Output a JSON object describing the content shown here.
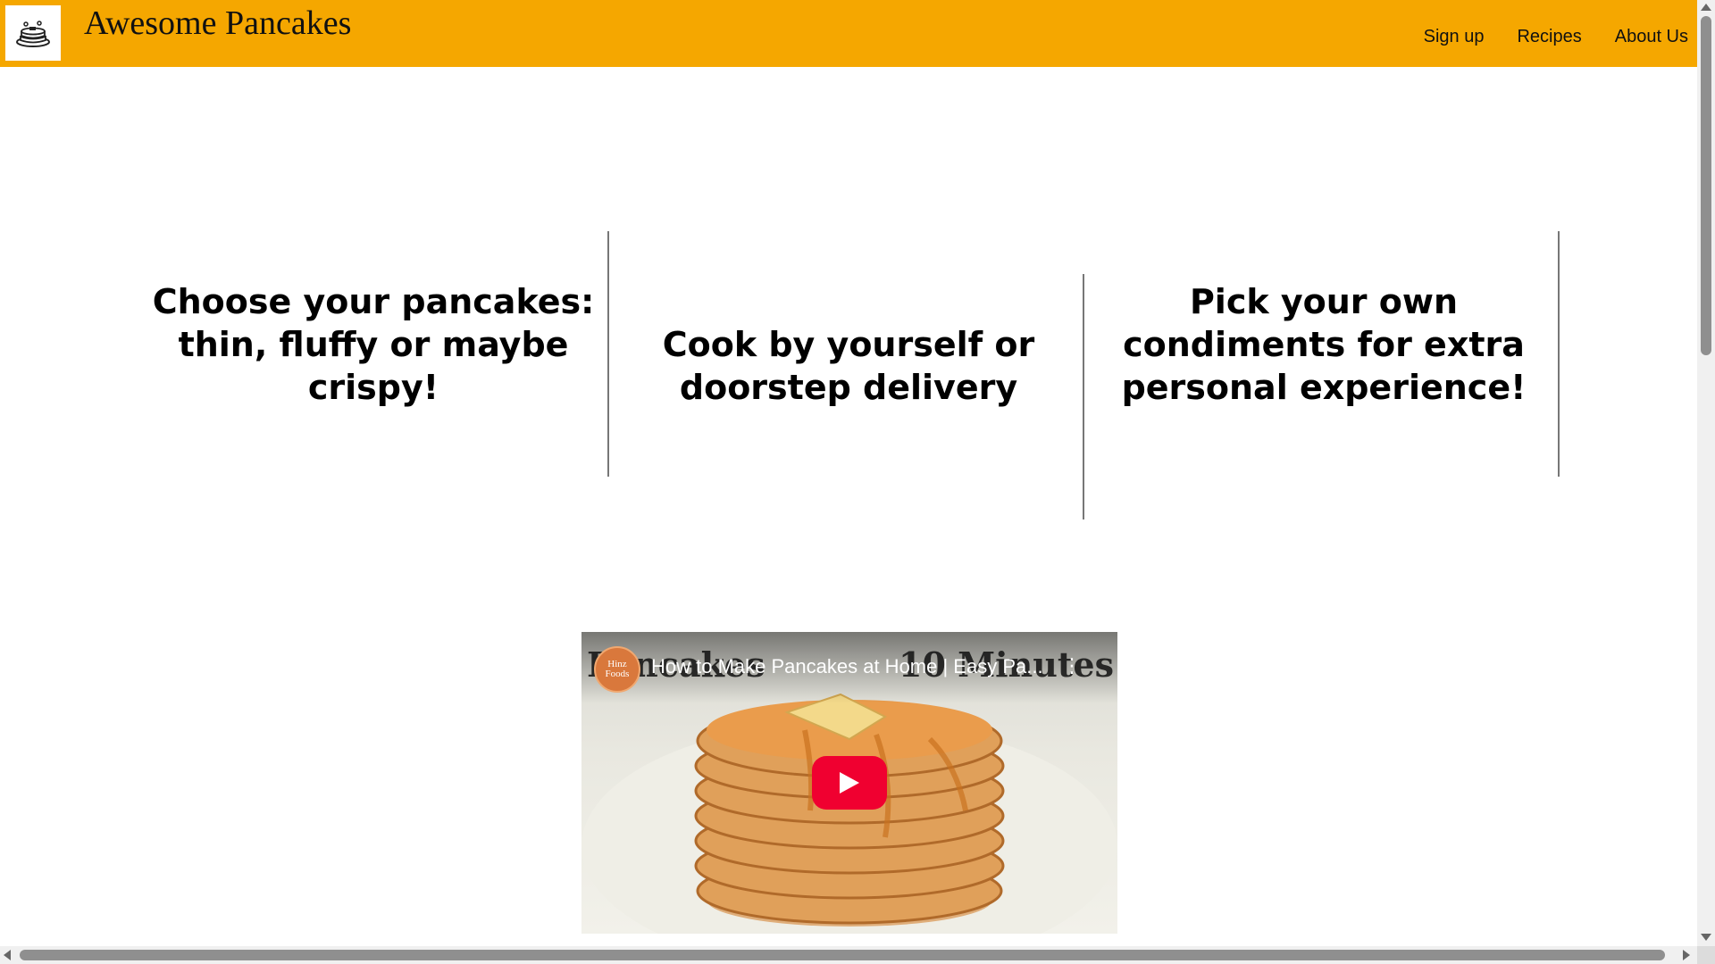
{
  "header": {
    "brand": "Awesome Pancakes",
    "logo_icon": "pancake-stack-icon",
    "nav": [
      {
        "label": "Sign up"
      },
      {
        "label": "Recipes"
      },
      {
        "label": "About Us"
      }
    ],
    "background_color": "#f5a700"
  },
  "features": [
    {
      "text": "Choose your pancakes: thin, fluffy or maybe crispy!"
    },
    {
      "text": "Cook by yourself or doorstep delivery"
    },
    {
      "text": "Pick your own condiments for extra personal experience!"
    }
  ],
  "video": {
    "title": "How to Make Pancakes at Home | Easy Pa...",
    "channel_badge": "Hinz Foods",
    "overlay_left": "Pancakes",
    "overlay_right": "10 Minutes",
    "play_icon": "youtube-play-icon",
    "menu_icon": "kebab-menu-icon",
    "play_color": "#f00030"
  }
}
